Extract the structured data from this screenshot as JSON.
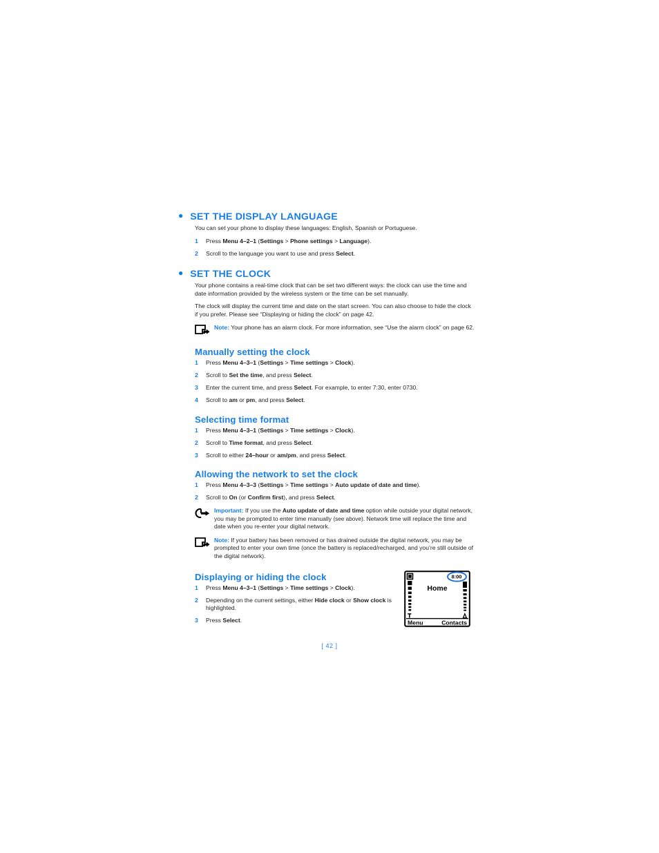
{
  "page": {
    "number_label": "[ 42 ]",
    "number": "42"
  },
  "colors": {
    "heading_blue": "#1a7ee5",
    "body_black": "#231f20",
    "page_number_blue": "#2b86e8",
    "highlight_circle_blue": "#1a6fd4"
  },
  "sections": [
    {
      "id": "set-the-display-language",
      "title": "SET THE DISPLAY LANGUAGE",
      "intro": "You can set your phone to display these languages: English, Spanish or Portuguese.",
      "steps": [
        {
          "num": "1",
          "text": "Press Menu 4-2-1 (Settings > Phone settings > Language)."
        },
        {
          "num": "2",
          "text": "Scroll to the language you want to use and press Select."
        }
      ]
    },
    {
      "id": "set-the-clock",
      "title": "SET THE CLOCK",
      "para1": "Your phone contains a real-time clock that can be set two different ways: the clock can use the time and date information provided by the wireless system or the time can be set manually.",
      "para2": "The clock will display the current time and date on the start screen. You can also choose to hide the clock if you prefer. Please see “Displaying or hiding the clock” on page 42.",
      "note": {
        "label": "Note:",
        "text": "Your phone has an alarm clock. For more information, see “Use the alarm clock” on page 62.",
        "icon": "note-icon"
      }
    }
  ],
  "subsections": [
    {
      "id": "manually-setting-the-clock",
      "title": "Manually setting the clock",
      "steps": [
        {
          "num": "1",
          "text": "Press Menu 4-3-1 (Settings > Time settings > Clock)."
        },
        {
          "num": "2",
          "text": "Scroll to Set the time, and press Select."
        },
        {
          "num": "3",
          "text": "Enter the current time, and press Select. For example, to enter 7:30, enter 0730."
        },
        {
          "num": "4",
          "text": "Scroll to am or pm, and press Select."
        }
      ]
    },
    {
      "id": "selecting-time-format",
      "title": "Selecting time format",
      "steps": [
        {
          "num": "1",
          "text": "Press Menu 4-3-1 (Settings > Time settings > Clock)."
        },
        {
          "num": "2",
          "text": "Scroll to Time format, and press Select."
        },
        {
          "num": "3",
          "text": "Scroll to either 24-hour or am/pm, and press Select."
        }
      ]
    },
    {
      "id": "allowing-the-network-to-set-the-clock",
      "title": "Allowing the network to set the clock",
      "steps": [
        {
          "num": "1",
          "text": "Press Menu 4-3-3 (Settings > Time settings > Auto update of date and time)."
        },
        {
          "num": "2",
          "text": "Scroll to On (or Confirm first), and press Select."
        }
      ],
      "important": {
        "label": "Important:",
        "text": "If you use the Auto update of date and time option while outside your digital network, you may be prompted to enter time manually (see above). Network time will replace the time and date when you re-enter your digital network.",
        "icon": "important-icon"
      },
      "note": {
        "label": "Note:",
        "text": "If your battery has been removed or has drained outside the digital network, you may be prompted to enter your own time (once the battery is replaced/recharged, and you're still outside of the digital network).",
        "icon": "note-icon"
      }
    },
    {
      "id": "displaying-or-hiding-the-clock",
      "title": "Displaying or hiding the clock",
      "steps": [
        {
          "num": "1",
          "text": "Press Menu 4-3-1 (Settings > Time settings > Clock)."
        },
        {
          "num": "2",
          "text": "Depending on the current settings, either Hide clock or Show clock is highlighted."
        },
        {
          "num": "3",
          "text": "Press Select."
        }
      ]
    }
  ],
  "phone_illustration": {
    "clock_text": "8:00",
    "main_text": "Home",
    "left_softkey": "Menu",
    "right_softkey": "Contacts",
    "signal_icon": "signal-strength-icon",
    "battery_icon": "battery-icon",
    "envelope_icon": "message-envelope-icon",
    "highlight": "clock-highlight-ellipse"
  }
}
